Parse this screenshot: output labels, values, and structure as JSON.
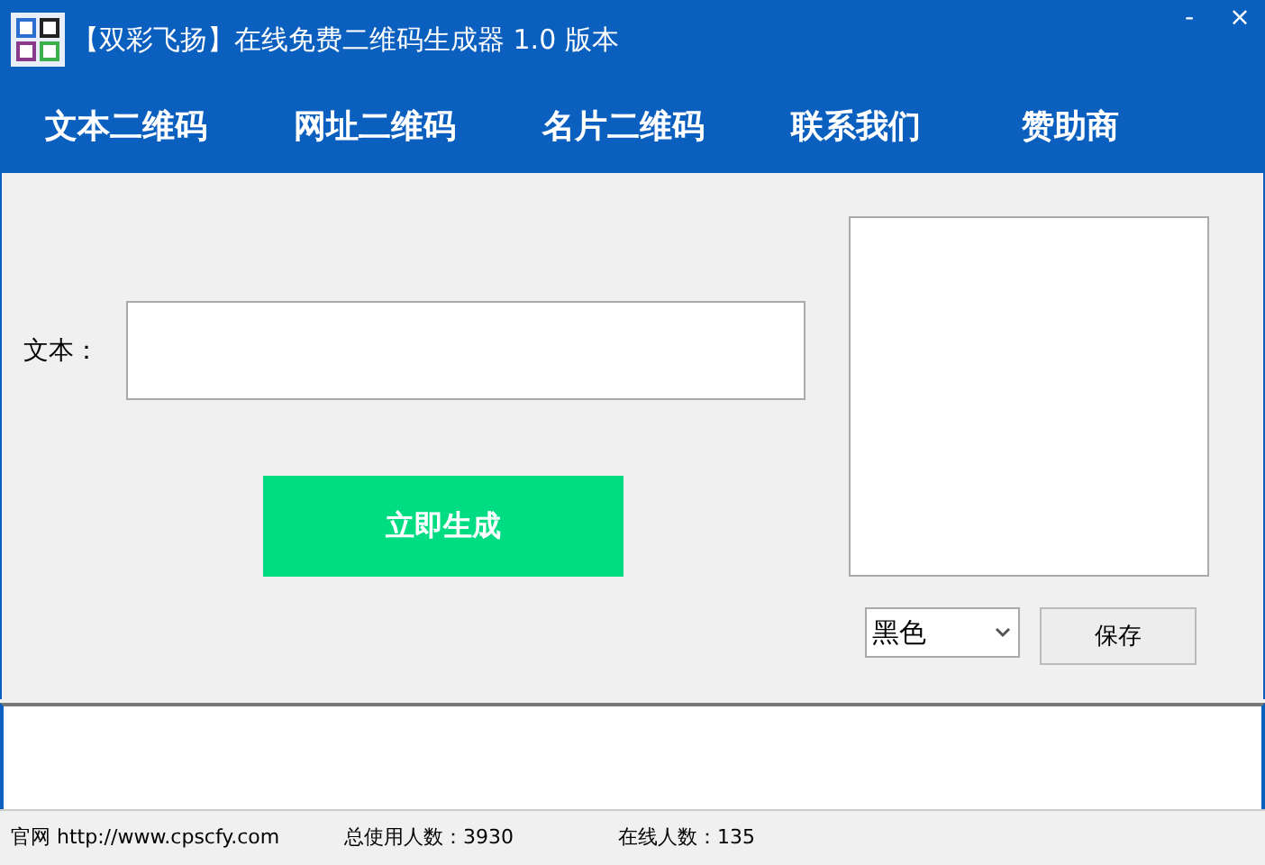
{
  "window": {
    "title": "【双彩飞扬】在线免费二维码生成器 1.0 版本",
    "controls": [
      "-",
      "×"
    ]
  },
  "nav": [
    {
      "label": "文本二维码"
    },
    {
      "label": "网址二维码"
    },
    {
      "label": "名片二维码"
    },
    {
      "label": "联系我们"
    },
    {
      "label": "赞助商"
    }
  ],
  "form": {
    "label": "文本：",
    "generate_button": "立即生成",
    "color_select": "黑色",
    "save_button": "保存"
  },
  "status_bar": [
    "官网 http://www.cpscfy.com",
    "总使用人数：3930",
    "在线人数：135"
  ]
}
